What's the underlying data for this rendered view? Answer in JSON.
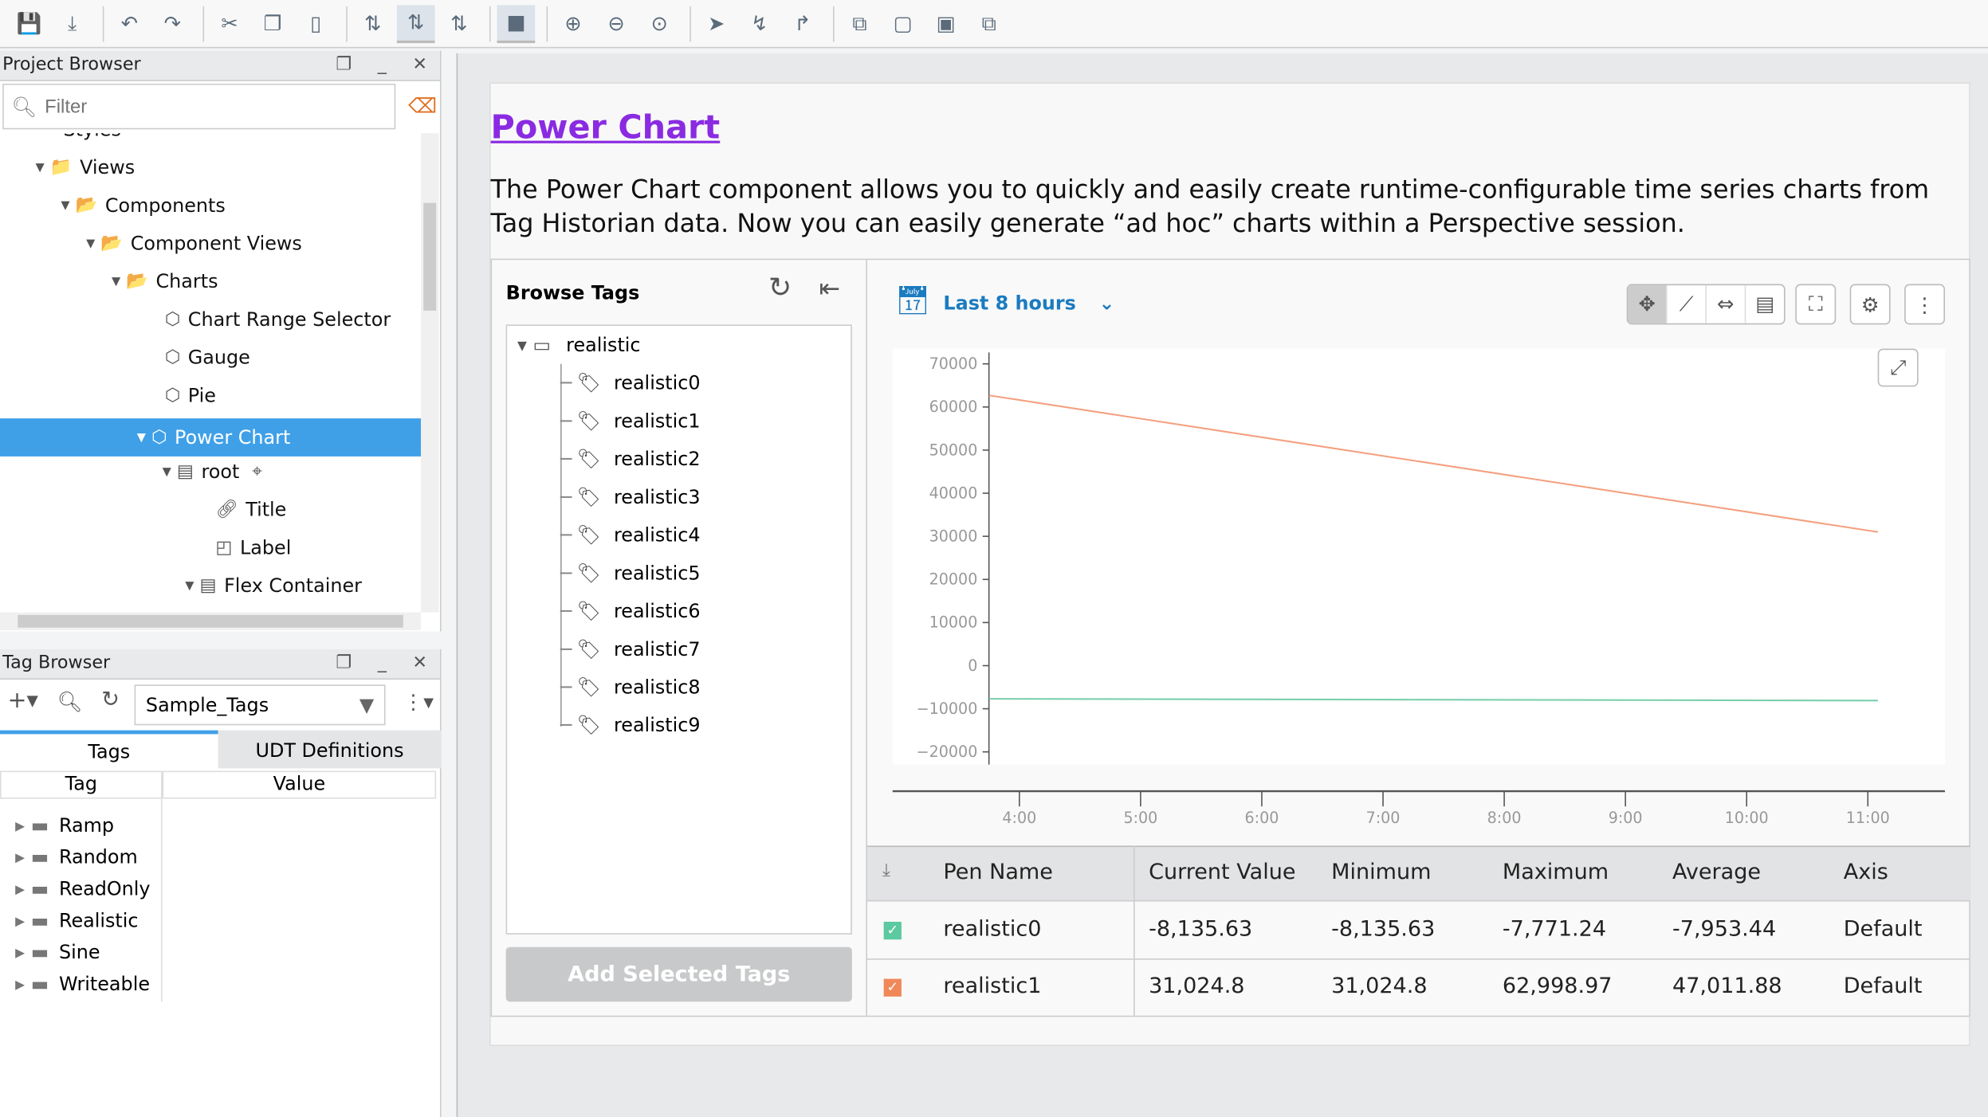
{
  "toolbar": {
    "icons": [
      "save-icon",
      "save-as-icon",
      "undo-icon",
      "redo-icon",
      "cut-icon",
      "copy-icon",
      "paste-icon",
      "snap-off-icon",
      "snap-icon",
      "snap-vertical-icon",
      "stop-icon",
      "zoom-in-icon",
      "zoom-out-icon",
      "zoom-fit-icon",
      "pointer-icon",
      "connect-icon",
      "route-icon",
      "group-icon",
      "ungroup-icon",
      "back-icon",
      "front-icon"
    ]
  },
  "project_browser": {
    "title": "Project Browser",
    "filter_placeholder": "Filter",
    "items": [
      {
        "label": "Styles"
      },
      {
        "label": "Views"
      },
      {
        "label": "Components"
      },
      {
        "label": "Component Views"
      },
      {
        "label": "Charts"
      },
      {
        "label": "Chart Range Selector"
      },
      {
        "label": "Gauge"
      },
      {
        "label": "Pie"
      },
      {
        "label": "Power Chart",
        "selected": true
      },
      {
        "label": "root"
      },
      {
        "label": "Title"
      },
      {
        "label": "Label"
      },
      {
        "label": "Flex Container"
      }
    ]
  },
  "tag_browser": {
    "title": "Tag Browser",
    "provider": "Sample_Tags",
    "tabs": [
      "Tags",
      "UDT Definitions"
    ],
    "active_tab": "Tags",
    "columns": [
      "Tag",
      "Value"
    ],
    "folders": [
      "Ramp",
      "Random",
      "ReadOnly",
      "Realistic",
      "Sine",
      "Writeable"
    ]
  },
  "page": {
    "title": "Power Chart",
    "description": "The Power Chart component allows you to quickly and easily create runtime-configurable time series charts from Tag Historian data. Now you can easily generate “ad hoc” charts within a Perspective session."
  },
  "browse_tags": {
    "title": "Browse Tags",
    "root": "realistic",
    "tags": [
      "realistic0",
      "realistic1",
      "realistic2",
      "realistic3",
      "realistic4",
      "realistic5",
      "realistic6",
      "realistic7",
      "realistic8",
      "realistic9"
    ],
    "add_button": "Add Selected Tags"
  },
  "range": {
    "label": "Last 8 hours"
  },
  "chart_data": {
    "type": "line",
    "ylim": [
      -20000,
      70000
    ],
    "yticks": [
      "70000",
      "60000",
      "50000",
      "40000",
      "30000",
      "20000",
      "10000",
      "0",
      "−10000",
      "−20000"
    ],
    "xticks": [
      "4:00",
      "5:00",
      "6:00",
      "7:00",
      "8:00",
      "9:00",
      "10:00",
      "11:00"
    ],
    "series": [
      {
        "color": "#f4a07f",
        "x": [
          "3:45",
          "11:05"
        ],
        "y": [
          62700,
          31000
        ]
      },
      {
        "color": "#7ccfae",
        "x": [
          "3:45",
          "11:05"
        ],
        "y": [
          -7700,
          -8100
        ]
      }
    ],
    "grid": false
  },
  "pens": {
    "columns": [
      "Pen Name",
      "Current Value",
      "Minimum",
      "Maximum",
      "Average",
      "Axis"
    ],
    "rows": [
      {
        "color": "#5cc9a0",
        "checked": true,
        "name": "realistic0",
        "current": "-8,135.63",
        "min": "-8,135.63",
        "max": "-7,771.24",
        "avg": "-7,953.44",
        "axis": "Default"
      },
      {
        "color": "#f0885a",
        "checked": true,
        "name": "realistic1",
        "current": "31,024.8",
        "min": "31,024.8",
        "max": "62,998.97",
        "avg": "47,011.88",
        "axis": "Default"
      }
    ]
  }
}
